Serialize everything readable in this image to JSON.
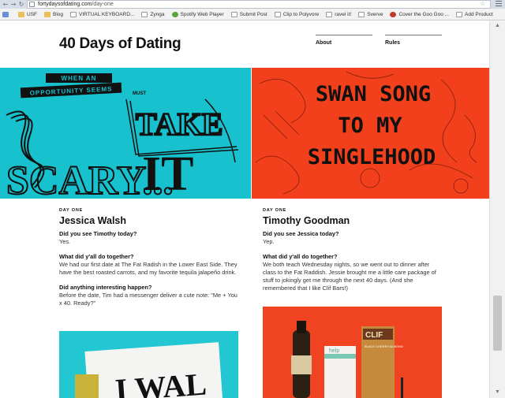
{
  "browser": {
    "url_host": "fortydaysofdating.com",
    "url_path": "/day-one",
    "bookmarks": [
      {
        "label": "USF",
        "icon": "folder-icon"
      },
      {
        "label": "Blog",
        "icon": "folder-icon"
      },
      {
        "label": "VIRTUAL KEYBOARD...",
        "icon": "page-icon"
      },
      {
        "label": "Zynga",
        "icon": "page-icon"
      },
      {
        "label": "Spotify Web Player",
        "icon": "spotify-icon"
      },
      {
        "label": "Submit Post",
        "icon": "page-icon"
      },
      {
        "label": "Clip to Polyvore",
        "icon": "page-icon"
      },
      {
        "label": "ravel it!",
        "icon": "page-icon"
      },
      {
        "label": "Sverve",
        "icon": "page-icon"
      },
      {
        "label": "Cover the Goo Goo ...",
        "icon": "red-dot-icon"
      },
      {
        "label": "Add Product",
        "icon": "page-icon"
      }
    ]
  },
  "site": {
    "title": "40 Days of Dating",
    "nav": {
      "about": "About",
      "rules": "Rules"
    }
  },
  "hero": {
    "left": {
      "line1": "WHEN AN",
      "line2": "OPPORTUNITY SEEMS",
      "line3": "MUST",
      "word_scary": "SCARY...",
      "word_take": "TAKE",
      "word_it": "IT"
    },
    "right": {
      "line1": "SWAN SONG",
      "line2": "TO MY",
      "line3": "SINGLEHOOD"
    }
  },
  "columns": {
    "left": {
      "day": "DAY ONE",
      "author": "Jessica Walsh",
      "qa": [
        {
          "q": "Did you see Timothy today?",
          "a": "Yes."
        },
        {
          "q": "What did y'all do together?",
          "a": "We had our first date at The Fat Radish in the Lower East Side. They have the best roasted carrots, and my favorite tequila jalapeño drink."
        },
        {
          "q": "Did anything interesting happen?",
          "a": "Before the date, Tim had a messenger deliver a cute note: \"Me + You x 40. Ready?\""
        }
      ]
    },
    "right": {
      "day": "DAY ONE",
      "author": "Timothy Goodman",
      "qa": [
        {
          "q": "Did you see Jessica today?",
          "a": "Yep."
        },
        {
          "q": "What did y'all do together?",
          "a": "We both teach Wednesday nights, so we went out to dinner after class to the Fat Raddish. Jessie brought me a little care package of stuff to jokingly get me through the next 40 days. (And she remembered that I like Clif Bars!)"
        }
      ]
    }
  },
  "photos": {
    "left_text": "I WAL",
    "right_bar_brand": "CLIF",
    "right_bar_flavor": "BLACK CHERRY ALMOND",
    "right_box_text": "help"
  },
  "colors": {
    "hero_left": "#17c1cd",
    "hero_right": "#f2401c",
    "ink": "#111111"
  }
}
